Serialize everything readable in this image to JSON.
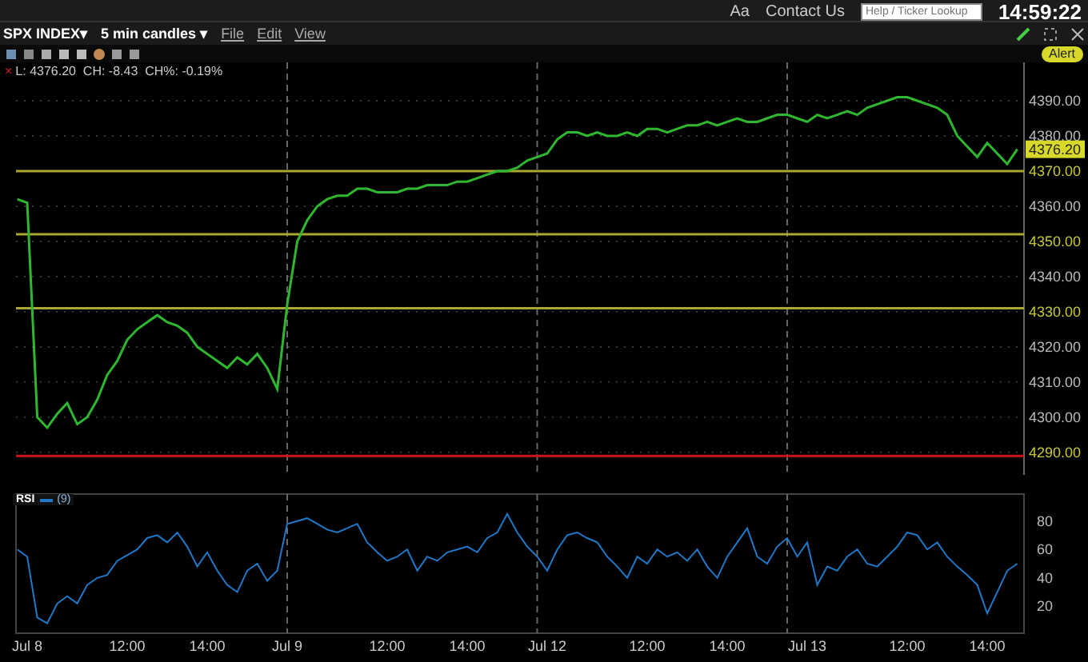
{
  "top_bar": {
    "font_button": "Aa",
    "contact": "Contact Us",
    "search": {
      "placeholder": "Help / Ticker Lookup"
    },
    "clock": "14:59:22"
  },
  "panel": {
    "symbol": {
      "label": "SPX INDEX",
      "caret": "▾"
    },
    "interval": {
      "label": "5 min candles",
      "caret": "▾"
    },
    "menus": [
      "File",
      "Edit",
      "View"
    ],
    "alert_button": "Alert"
  },
  "quote_line": {
    "close_mark": "×",
    "text": "L: 4376.20  CH: -8.43  CH%: -0.19%"
  },
  "price_chart": {
    "last_price": "4376.20",
    "chart_data": {
      "type": "line",
      "series": [
        {
          "color": "#2fb82f",
          "values": [
            4362,
            4361,
            4300,
            4297,
            4301,
            4304,
            4298,
            4300,
            4305,
            4312,
            4316,
            4322,
            4325,
            4327,
            4329,
            4327,
            4326,
            4324,
            4320,
            4318,
            4316,
            4314,
            4317,
            4315,
            4318,
            4314,
            4308,
            4332,
            4350,
            4356,
            4360,
            4362,
            4363,
            4363,
            4365,
            4365,
            4364,
            4364,
            4364,
            4365,
            4365,
            4366,
            4366,
            4366,
            4367,
            4367,
            4368,
            4369,
            4370,
            4370,
            4371,
            4373,
            4374,
            4375,
            4379,
            4381,
            4381,
            4380,
            4381,
            4380,
            4380,
            4381,
            4380,
            4382,
            4382,
            4381,
            4382,
            4383,
            4383,
            4384,
            4383,
            4384,
            4385,
            4384,
            4384,
            4385,
            4386,
            4386,
            4385,
            4384,
            4386,
            4385,
            4386,
            4387,
            4386,
            4388,
            4389,
            4390,
            4391,
            4391,
            4390,
            4389,
            4388,
            4386,
            4380,
            4377,
            4374,
            4378,
            4375,
            4372,
            4376.2
          ]
        }
      ],
      "ylim": [
        4283.6,
        4400.9
      ],
      "yticks": [
        {
          "value": 4290,
          "label": "4290.00"
        },
        {
          "value": 4300,
          "label": "4300.00"
        },
        {
          "value": 4310,
          "label": "4310.00"
        },
        {
          "value": 4320,
          "label": "4320.00"
        },
        {
          "value": 4330,
          "label": "4330.00"
        },
        {
          "value": 4340,
          "label": "4340.00"
        },
        {
          "value": 4350,
          "label": "4350.00"
        },
        {
          "value": 4360,
          "label": "4360.00"
        },
        {
          "value": 4370,
          "label": "4370.00"
        },
        {
          "value": 4380,
          "label": "4380.00"
        },
        {
          "value": 4390,
          "label": "4390.00"
        }
      ],
      "grid": true,
      "ref_lines": [
        {
          "axis": "y",
          "value": 4370,
          "color": "#a8a832"
        },
        {
          "axis": "y",
          "value": 4352,
          "color": "#a8a832"
        },
        {
          "axis": "y",
          "value": 4331,
          "color": "#a8a832"
        },
        {
          "axis": "y",
          "value": 4289,
          "color": "#c81818"
        }
      ]
    }
  },
  "rsi_chart": {
    "label": "RSI",
    "legend": "(9)",
    "chart_data": {
      "type": "line",
      "categories": [
        null,
        "Jul 8",
        null,
        null,
        null,
        null,
        null,
        null,
        null,
        null,
        null,
        "12:00",
        null,
        null,
        null,
        null,
        null,
        null,
        null,
        "14:00",
        null,
        null,
        null,
        null,
        null,
        null,
        null,
        "Jul 9",
        null,
        null,
        null,
        null,
        null,
        null,
        null,
        null,
        null,
        "12:00",
        null,
        null,
        null,
        null,
        null,
        null,
        null,
        "14:00",
        null,
        null,
        null,
        null,
        null,
        null,
        null,
        "Jul 12",
        null,
        null,
        null,
        null,
        null,
        null,
        null,
        null,
        null,
        "12:00",
        null,
        null,
        null,
        null,
        null,
        null,
        null,
        "14:00",
        null,
        null,
        null,
        null,
        null,
        null,
        null,
        "Jul 13",
        null,
        null,
        null,
        null,
        null,
        null,
        null,
        null,
        null,
        "12:00",
        null,
        null,
        null,
        null,
        null,
        null,
        null,
        "14:00",
        null,
        null,
        null
      ],
      "series": [
        {
          "color": "#1f78c8",
          "values": [
            60,
            55,
            12,
            8,
            22,
            27,
            22,
            35,
            40,
            42,
            52,
            56,
            60,
            68,
            70,
            65,
            72,
            62,
            48,
            58,
            45,
            35,
            30,
            45,
            50,
            38,
            45,
            78,
            80,
            82,
            78,
            74,
            72,
            75,
            78,
            65,
            58,
            52,
            55,
            60,
            45,
            55,
            52,
            58,
            60,
            62,
            58,
            68,
            72,
            85,
            72,
            62,
            55,
            45,
            60,
            70,
            72,
            68,
            65,
            55,
            48,
            40,
            55,
            50,
            60,
            55,
            58,
            52,
            60,
            48,
            40,
            55,
            65,
            75,
            55,
            50,
            62,
            68,
            55,
            65,
            35,
            48,
            45,
            55,
            60,
            50,
            48,
            55,
            62,
            72,
            70,
            60,
            65,
            55,
            48,
            42,
            35,
            15,
            30,
            45,
            50
          ]
        }
      ],
      "ylim": [
        1,
        99
      ],
      "yticks": [
        20,
        40,
        60,
        80
      ],
      "grid": true
    }
  }
}
